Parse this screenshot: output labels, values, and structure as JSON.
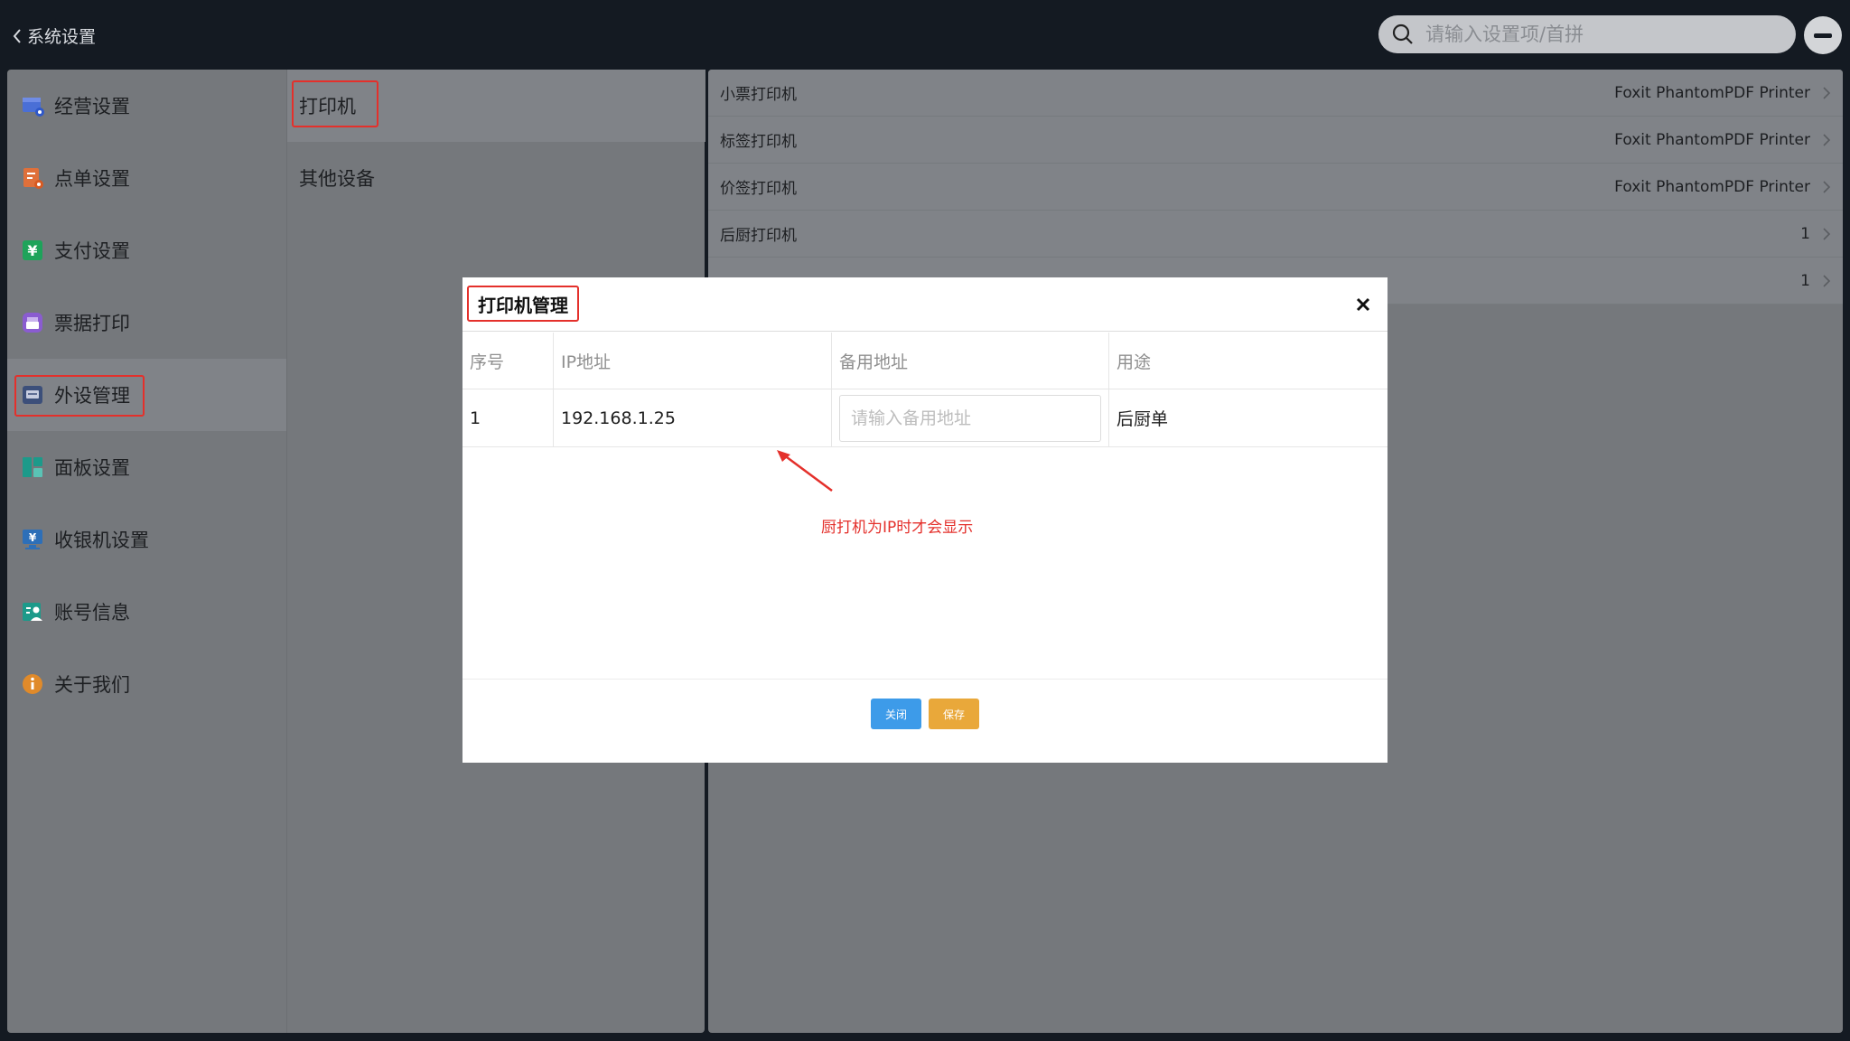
{
  "topbar": {
    "back_label": "系统设置",
    "search_placeholder": "请输入设置项/首拼"
  },
  "sidebar": {
    "items": [
      {
        "label": "经营设置",
        "icon": "store-settings-icon",
        "color": "#4a6fd6"
      },
      {
        "label": "点单设置",
        "icon": "order-settings-icon",
        "color": "#e0703a"
      },
      {
        "label": "支付设置",
        "icon": "payment-yuan-icon",
        "color": "#1ea35a"
      },
      {
        "label": "票据打印",
        "icon": "receipt-print-icon",
        "color": "#8a5cd0"
      },
      {
        "label": "外设管理",
        "icon": "peripheral-icon",
        "color": "#3c4f7a",
        "active": true
      },
      {
        "label": "面板设置",
        "icon": "panel-layout-icon",
        "color": "#1c9a8a"
      },
      {
        "label": "收银机设置",
        "icon": "cashier-monitor-icon",
        "color": "#2d6fb8"
      },
      {
        "label": "账号信息",
        "icon": "account-info-icon",
        "color": "#1c9a8a"
      },
      {
        "label": "关于我们",
        "icon": "info-icon",
        "color": "#e08a2a"
      }
    ]
  },
  "subnav": {
    "items": [
      {
        "label": "打印机",
        "active": true
      },
      {
        "label": "其他设备"
      }
    ]
  },
  "settings": {
    "rows": [
      {
        "label": "小票打印机",
        "value": "Foxit PhantomPDF Printer"
      },
      {
        "label": "标签打印机",
        "value": "Foxit PhantomPDF Printer"
      },
      {
        "label": "价签打印机",
        "value": "Foxit PhantomPDF Printer"
      },
      {
        "label": "后厨打印机",
        "value": "1"
      },
      {
        "label": "",
        "value": "1"
      }
    ]
  },
  "dialog": {
    "title": "打印机管理",
    "columns": [
      "序号",
      "IP地址",
      "备用地址",
      "用途"
    ],
    "row": {
      "index": "1",
      "ip": "192.168.1.25",
      "backup_placeholder": "请输入备用地址",
      "backup_value": "",
      "purpose": "后厨单"
    },
    "note": "厨打机为IP时才会显示",
    "close_label": "关闭",
    "save_label": "保存"
  },
  "colors": {
    "highlight_red": "#e4302b",
    "close_button": "#3d9be9",
    "save_button": "#e9a83a",
    "overlay": "#75787c"
  }
}
